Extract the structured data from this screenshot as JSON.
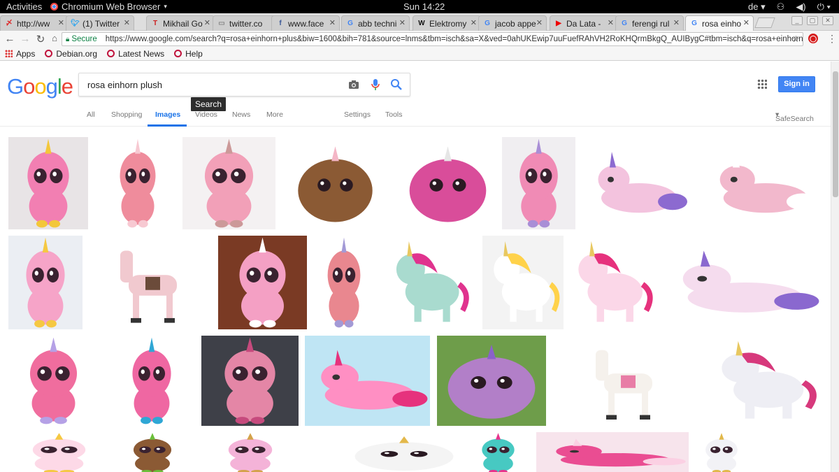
{
  "topbar": {
    "activities": "Activities",
    "app_name": "Chromium Web Browser",
    "clock": "Sun 14:22",
    "lang": "de"
  },
  "tabs": [
    {
      "title": "http://ww",
      "favicon": "red-swoosh"
    },
    {
      "title": "(1) Twitter",
      "favicon": "twitter-bird"
    },
    {
      "title": "Mikhail Go",
      "favicon": "T"
    },
    {
      "title": "twitter.co",
      "favicon": "page"
    },
    {
      "title": "www.face",
      "favicon": "f"
    },
    {
      "title": "abb techni",
      "favicon": "G"
    },
    {
      "title": "Elektromy",
      "favicon": "W"
    },
    {
      "title": "jacob appe",
      "favicon": "G"
    },
    {
      "title": "Da Lata -",
      "favicon": "youtube"
    },
    {
      "title": "ferengi rul",
      "favicon": "G"
    },
    {
      "title": "rosa einho",
      "favicon": "G",
      "active": true
    }
  ],
  "address": {
    "secure_label": "Secure",
    "url": "https://www.google.com/search?q=rosa+einhorn+plus&biw=1600&bih=781&source=lnms&tbm=isch&sa=X&ved=0ahUKEwip7uuFuefRAhVH2RoKHQrmBkgQ_AUIBygC#tbm=isch&q=rosa+einhorn+plush"
  },
  "bookmarks": [
    {
      "label": "Apps",
      "icon": "apps-grid-icon"
    },
    {
      "label": "Debian.org",
      "icon": "debian-icon"
    },
    {
      "label": "Latest News",
      "icon": "debian-icon"
    },
    {
      "label": "Help",
      "icon": "debian-icon"
    }
  ],
  "google": {
    "logo": [
      "G",
      "o",
      "o",
      "g",
      "l",
      "e"
    ],
    "logo_colors": [
      "#4285f4",
      "#ea4335",
      "#fbbc05",
      "#4285f4",
      "#34a853",
      "#ea4335"
    ],
    "query": "rosa einhorn plush",
    "tooltip": "Search",
    "signin": "Sign in",
    "tabs": {
      "all": "All",
      "shopping": "Shopping",
      "images": "Images",
      "videos": "Videos",
      "news": "News",
      "more": "More",
      "settings": "Settings",
      "tools": "Tools",
      "safesearch": "SafeSearch"
    }
  },
  "results": [
    {
      "bg": "#e8e4e6",
      "toy": "#f27fb2",
      "accent": "#f3c73a",
      "kind": "beanie"
    },
    {
      "bg": "#ffffff",
      "toy": "#ef8c9c",
      "accent": "#f7c9d2",
      "kind": "beanie"
    },
    {
      "bg": "#f4f1f2",
      "toy": "#f2a0b8",
      "accent": "#c99",
      "kind": "beanie"
    },
    {
      "bg": "#ffffff",
      "toy": "#8b5a34",
      "accent": "#f4b6c6",
      "kind": "fluffy"
    },
    {
      "bg": "#ffffff",
      "toy": "#d94d9a",
      "accent": "#e6e6e6",
      "kind": "fluffy"
    },
    {
      "bg": "#f0eef1",
      "toy": "#f08bb5",
      "accent": "#a98ed6",
      "kind": "beanie"
    },
    {
      "bg": "#ffffff",
      "toy": "#f3c3de",
      "accent": "#8c6ad0",
      "kind": "lying"
    },
    {
      "bg": "#ffffff",
      "toy": "#f2b8cc",
      "accent": "#ffffff",
      "kind": "lying"
    },
    {
      "bg": "#ebeef3",
      "toy": "#f6a4c8",
      "accent": "#f5c842",
      "kind": "beanie"
    },
    {
      "bg": "#ffffff",
      "toy": "#f1c9cf",
      "accent": "#6b4b3a",
      "kind": "horse"
    },
    {
      "bg": "#7a3a24",
      "toy": "#f4a0c4",
      "accent": "#ffffff",
      "kind": "beanie"
    },
    {
      "bg": "#ffffff",
      "toy": "#e9878f",
      "accent": "#a39ad6",
      "kind": "beanie"
    },
    {
      "bg": "#ffffff",
      "toy": "#a9dbcf",
      "accent": "#e0338e",
      "kind": "standing"
    },
    {
      "bg": "#f3f3f3",
      "toy": "#ffffff",
      "accent": "#ffd24a",
      "kind": "standing"
    },
    {
      "bg": "#ffffff",
      "toy": "#fbd7e8",
      "accent": "#e6327d",
      "kind": "standing"
    },
    {
      "bg": "#ffffff",
      "toy": "#f5dcee",
      "accent": "#8a68cf",
      "kind": "lying"
    },
    {
      "bg": "#ffffff",
      "toy": "#f06d9e",
      "accent": "#b5a1e6",
      "kind": "beanie"
    },
    {
      "bg": "#ffffff",
      "toy": "#ef67a2",
      "accent": "#2fa7d5",
      "kind": "beanie"
    },
    {
      "bg": "#3e4048",
      "toy": "#e486a6",
      "accent": "#c64a7d",
      "kind": "beanie"
    },
    {
      "bg": "#bfe5f4",
      "toy": "#ff8fc3",
      "accent": "#e6327d",
      "kind": "lying"
    },
    {
      "bg": "#6e9d4a",
      "toy": "#b27fc8",
      "accent": "#8a62c9",
      "kind": "fluffy"
    },
    {
      "bg": "#ffffff",
      "toy": "#f5f1ec",
      "accent": "#e87da6",
      "kind": "horse"
    },
    {
      "bg": "#ffffff",
      "toy": "#eeeef4",
      "accent": "#d7397c",
      "kind": "standing"
    },
    {
      "bg": "#ffffff",
      "toy": "#fdd9e7",
      "accent": "#f5c842",
      "kind": "beanie"
    },
    {
      "bg": "#ffffff",
      "toy": "#8b5a34",
      "accent": "#6bbf3a",
      "kind": "beanie"
    },
    {
      "bg": "#ffffff",
      "toy": "#f4b3d8",
      "accent": "#d4a24a",
      "kind": "beanie"
    },
    {
      "bg": "#ffffff",
      "toy": "#f4f4f4",
      "accent": "#e3b84a",
      "kind": "fluffy"
    },
    {
      "bg": "#ffffff",
      "toy": "#47c9c2",
      "accent": "#e7338c",
      "kind": "beanie"
    },
    {
      "bg": "#f7e4ec",
      "toy": "#ea4d92",
      "accent": "#fbd0e3",
      "kind": "lying"
    },
    {
      "bg": "#ffffff",
      "toy": "#f2f2f6",
      "accent": "#e1b84a",
      "kind": "beanie"
    }
  ]
}
